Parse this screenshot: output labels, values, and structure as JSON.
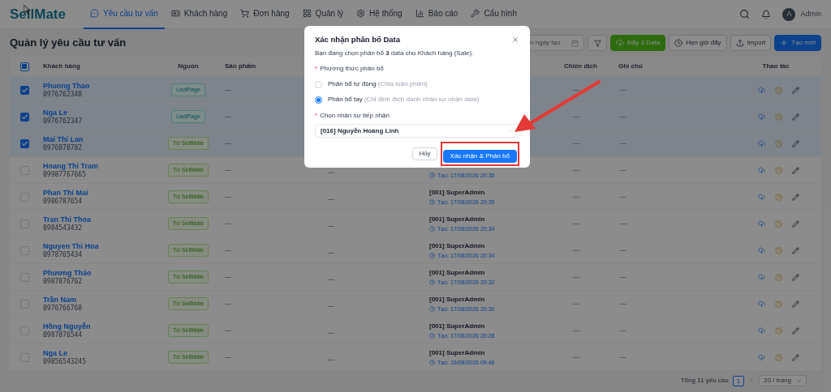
{
  "logo": {
    "text": "SellMate"
  },
  "nav": [
    {
      "label": "Yêu cầu tư vấn",
      "kind": "chat",
      "selected": true
    },
    {
      "label": "Khách hàng",
      "kind": "card",
      "selected": false
    },
    {
      "label": "Đơn hàng",
      "kind": "cart",
      "selected": false
    },
    {
      "label": "Quản lý",
      "kind": "grid",
      "selected": false
    },
    {
      "label": "Hệ thống",
      "kind": "gear",
      "selected": false
    },
    {
      "label": "Báo cáo",
      "kind": "chart",
      "selected": false
    },
    {
      "label": "Cấu hình",
      "kind": "wrench",
      "selected": false
    }
  ],
  "user": {
    "avatar": "A",
    "name": "Admin"
  },
  "page_title": "Quản lý yêu cầu tư vấn",
  "toolbar": {
    "date_placeholder": "n ngày tạo",
    "buttons": [
      {
        "label": "Đẩy 3 Data",
        "kind": "push"
      },
      {
        "label": "Hẹn giờ đẩy",
        "kind": "schedule"
      },
      {
        "label": "Import",
        "kind": "import"
      },
      {
        "label": "Tạo mới",
        "kind": "create"
      }
    ]
  },
  "table": {
    "indeterminate": true,
    "columns": [
      "Khách hàng",
      "Nguồn",
      "Sản phẩm",
      "Chiến dịch",
      "Ghi chú",
      "Thao tác"
    ],
    "rows": [
      {
        "name": "Phuong Thao",
        "phone": "0976762348",
        "source": "LadiPage",
        "kind": "ladipage",
        "checked": true,
        "product": "—",
        "campaign": "—",
        "note": "—"
      },
      {
        "name": "Nga Le",
        "phone": "0976762347",
        "source": "LadiPage",
        "kind": "ladipage",
        "checked": true,
        "product": "—",
        "campaign": "—",
        "note": "—"
      },
      {
        "name": "Mai Thi Lan",
        "phone": "0976878782",
        "source": "Từ SellMate",
        "kind": "sellmate",
        "checked": true,
        "product": "—",
        "campaign": "—",
        "note": "—"
      },
      {
        "name": "Hoang Thi Tram",
        "phone": "09987767665",
        "source": "Từ SellMate",
        "kind": "sellmate",
        "checked": false,
        "product": "—",
        "column_4": "—",
        "created": "Tạo: 17/06/2026 20:35",
        "campaign": "—",
        "note": "—"
      },
      {
        "name": "Phan Thi Mai",
        "phone": "0986787654",
        "source": "Từ SellMate",
        "kind": "sellmate",
        "checked": false,
        "product": "—",
        "column_4": "—",
        "assignee": "[001] SuperAdmin",
        "created": "Tạo: 17/06/2026 20:35",
        "campaign": "—",
        "note": "—"
      },
      {
        "name": "Tran Thi Thoa",
        "phone": "0984543432",
        "source": "Từ SellMate",
        "kind": "sellmate",
        "checked": false,
        "product": "—",
        "column_4": "—",
        "assignee": "[001] SuperAdmin",
        "created": "Tạo: 17/06/2026 20:34",
        "campaign": "—",
        "note": "—"
      },
      {
        "name": "Nguyen Thi Hoa",
        "phone": "0978765434",
        "source": "Từ SellMate",
        "kind": "sellmate",
        "checked": false,
        "product": "—",
        "column_4": "—",
        "assignee": "[001] SuperAdmin",
        "created": "Tạo: 17/06/2026 20:34",
        "campaign": "—",
        "note": "—"
      },
      {
        "name": "Phương Thảo",
        "phone": "0987876762",
        "source": "Từ SellMate",
        "kind": "sellmate",
        "checked": false,
        "product": "—",
        "column_4": "—",
        "assignee": "[001] SuperAdmin",
        "created": "Tạo: 17/06/2026 20:32",
        "campaign": "—",
        "note": "—"
      },
      {
        "name": "Trần Nam",
        "phone": "0976766768",
        "source": "Từ SellMate",
        "kind": "sellmate",
        "checked": false,
        "product": "—",
        "column_4": "—",
        "assignee": "[001] SuperAdmin",
        "created": "Tạo: 17/06/2026 20:30",
        "campaign": "—",
        "note": "—"
      },
      {
        "name": "Hồng Nguyễn",
        "phone": "0987876544",
        "source": "Từ SellMate",
        "kind": "sellmate",
        "checked": false,
        "product": "—",
        "column_4": "—",
        "assignee": "[001] SuperAdmin",
        "created": "Tạo: 17/06/2026 20:28",
        "campaign": "—",
        "note": "—"
      },
      {
        "name": "Nga Le",
        "phone": "09856543245",
        "source": "Từ SellMate",
        "kind": "sellmate",
        "checked": false,
        "product": "—",
        "column_4": "—",
        "assignee": "[001] SuperAdmin",
        "created": "Tạo: 16/06/2026 09:46",
        "campaign": "—",
        "note": "—"
      }
    ]
  },
  "pagination": {
    "total": "Tổng 11 yêu cầu",
    "page": "1",
    "page_size": "20 / trang"
  },
  "required_mark": "*",
  "modal": {
    "title": "Xác nhận phân bổ Data",
    "description": "Bạn đang chọn phân bổ **3** data cho Khách hàng (Sale).",
    "method_label": "Phương thức phân bổ",
    "options": [
      {
        "label": "Phân bổ tự động",
        "hint": "(Chia luân phiên)",
        "selected": false
      },
      {
        "label": "Phân bổ tay",
        "hint": "(Chỉ định đích danh nhân sự nhận data)",
        "selected": true
      }
    ],
    "staff_label": "Chọn nhân sự tiếp nhận",
    "staff_value": "[016] Nguyễn Hoàng Linh",
    "cancel": "Hủy",
    "confirm": "Xác nhận & Phân bổ"
  }
}
